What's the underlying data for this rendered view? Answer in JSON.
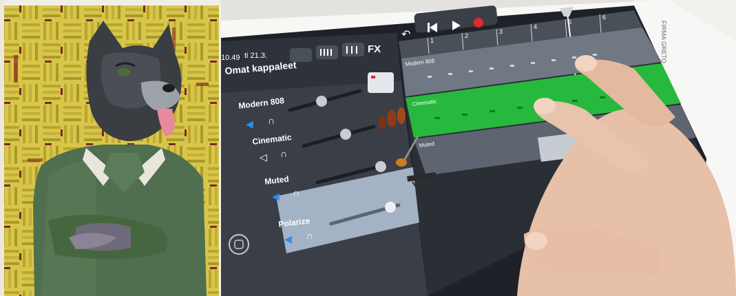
{
  "photo_left": {
    "subject": "cat-figure-relief-painting"
  },
  "photo_right": {
    "status_bar": {
      "time": "10.49",
      "date": "ti 21.3."
    },
    "header": {
      "title": "Omat kappaleet"
    },
    "toolbar": {
      "fx_label": "FX"
    },
    "ruler": {
      "marks": [
        "1",
        "2",
        "3",
        "4",
        "5",
        "6"
      ]
    },
    "tracks": [
      {
        "name": "Modern 808",
        "region_label": "Modern 808",
        "volume": 0.35,
        "instrument_icon": "drum-machine-icon",
        "muted": false,
        "selected": false
      },
      {
        "name": "Cinematic",
        "region_label": "Cinematic",
        "volume": 0.6,
        "instrument_icon": "violin-icon",
        "muted": true,
        "selected": false
      },
      {
        "name": "Muted",
        "region_label": "Muted",
        "volume": 0.95,
        "instrument_icon": "electric-guitar-icon",
        "muted": false,
        "selected": false
      },
      {
        "name": "Polarize",
        "region_label": "",
        "volume": 0.85,
        "instrument_icon": "keyboard-icon",
        "muted": false,
        "selected": true
      }
    ],
    "case_label": "FIRMA GRETO",
    "colors": {
      "accent_green": "#27b93d",
      "record_red": "#e02b2b",
      "speaker_blue": "#2a8ff0"
    }
  }
}
